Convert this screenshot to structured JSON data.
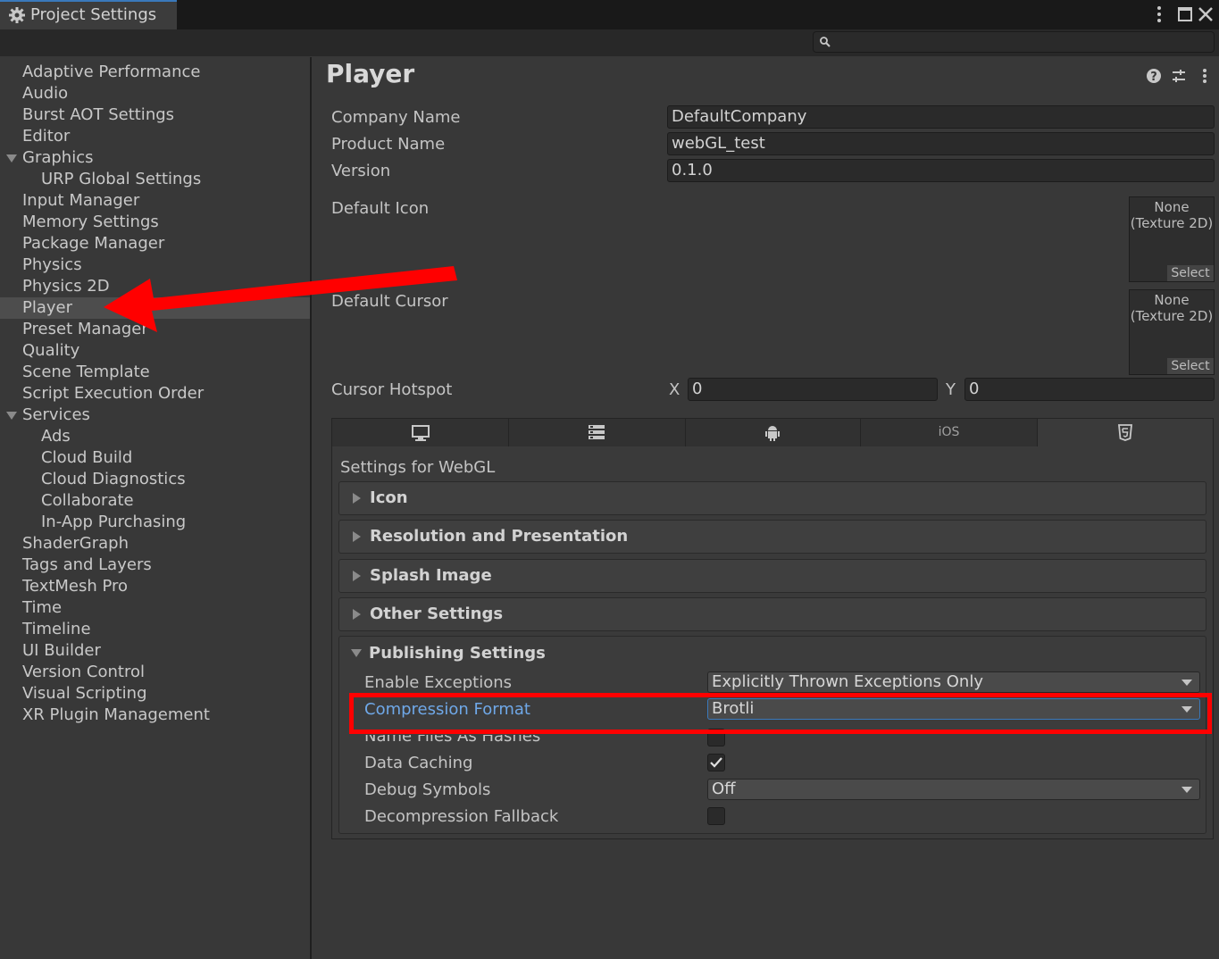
{
  "window": {
    "title": "Project Settings",
    "search_placeholder": ""
  },
  "sidebar": {
    "items": [
      {
        "label": "Adaptive Performance"
      },
      {
        "label": "Audio"
      },
      {
        "label": "Burst AOT Settings"
      },
      {
        "label": "Editor"
      },
      {
        "label": "Graphics",
        "expanded": true
      },
      {
        "label": "URP Global Settings",
        "child": true
      },
      {
        "label": "Input Manager"
      },
      {
        "label": "Memory Settings"
      },
      {
        "label": "Package Manager"
      },
      {
        "label": "Physics"
      },
      {
        "label": "Physics 2D"
      },
      {
        "label": "Player",
        "selected": true
      },
      {
        "label": "Preset Manager"
      },
      {
        "label": "Quality"
      },
      {
        "label": "Scene Template"
      },
      {
        "label": "Script Execution Order"
      },
      {
        "label": "Services",
        "expanded": true
      },
      {
        "label": "Ads",
        "child": true
      },
      {
        "label": "Cloud Build",
        "child": true
      },
      {
        "label": "Cloud Diagnostics",
        "child": true
      },
      {
        "label": "Collaborate",
        "child": true
      },
      {
        "label": "In-App Purchasing",
        "child": true
      },
      {
        "label": "ShaderGraph"
      },
      {
        "label": "Tags and Layers"
      },
      {
        "label": "TextMesh Pro"
      },
      {
        "label": "Time"
      },
      {
        "label": "Timeline"
      },
      {
        "label": "UI Builder"
      },
      {
        "label": "Version Control"
      },
      {
        "label": "Visual Scripting"
      },
      {
        "label": "XR Plugin Management"
      }
    ]
  },
  "player": {
    "title": "Player",
    "company_name_label": "Company Name",
    "company_name": "DefaultCompany",
    "product_name_label": "Product Name",
    "product_name": "webGL_test",
    "version_label": "Version",
    "version": "0.1.0",
    "default_icon_label": "Default Icon",
    "default_cursor_label": "Default Cursor",
    "object_none_line1": "None",
    "object_none_line2": "(Texture 2D)",
    "object_select": "Select",
    "cursor_hotspot_label": "Cursor Hotspot",
    "x_label": "X",
    "x_value": "0",
    "y_label": "Y",
    "y_value": "0"
  },
  "platform_tabs": {
    "ios_label": "iOS",
    "icons": [
      "monitor-icon",
      "server-icon",
      "android-icon",
      "ios",
      "html5-icon"
    ],
    "active": "html5-icon"
  },
  "webgl": {
    "settings_title": "Settings for WebGL",
    "foldouts": [
      "Icon",
      "Resolution and Presentation",
      "Splash Image",
      "Other Settings"
    ],
    "publishing": {
      "title": "Publishing Settings",
      "enable_exceptions_label": "Enable Exceptions",
      "enable_exceptions_value": "Explicitly Thrown Exceptions Only",
      "compression_format_label": "Compression Format",
      "compression_format_value": "Brotli",
      "name_files_label": "Name Files As Hashes",
      "name_files_checked": false,
      "data_caching_label": "Data Caching",
      "data_caching_checked": true,
      "debug_symbols_label": "Debug Symbols",
      "debug_symbols_value": "Off",
      "decompression_fallback_label": "Decompression Fallback",
      "decompression_fallback_checked": false
    }
  },
  "colors": {
    "background": "#383838",
    "annotation": "#ff0000",
    "highlight_label": "#6fa8e8"
  }
}
